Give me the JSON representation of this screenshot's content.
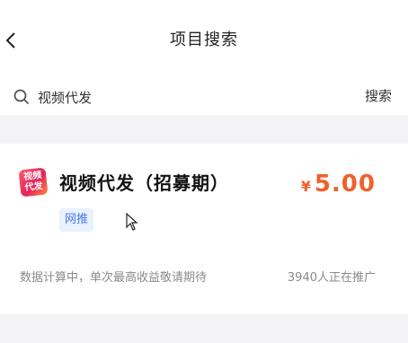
{
  "header": {
    "title": "项目搜索",
    "back_icon": "chevron-left-icon"
  },
  "search": {
    "value": "视频代发",
    "button_label": "搜索",
    "icon": "search-icon"
  },
  "item": {
    "icon_text_line1": "视频",
    "icon_text_line2": "代发",
    "title": "视频代发（招募期）",
    "price_currency": "¥",
    "price_value": "5.00",
    "tag": "网推",
    "note": "数据计算中，单次最高收益敬请期待",
    "promoters": "3940人正在推广"
  },
  "colors": {
    "price": "#f0602a",
    "tag_bg": "#eaf1ff",
    "tag_text": "#4a78e6"
  }
}
